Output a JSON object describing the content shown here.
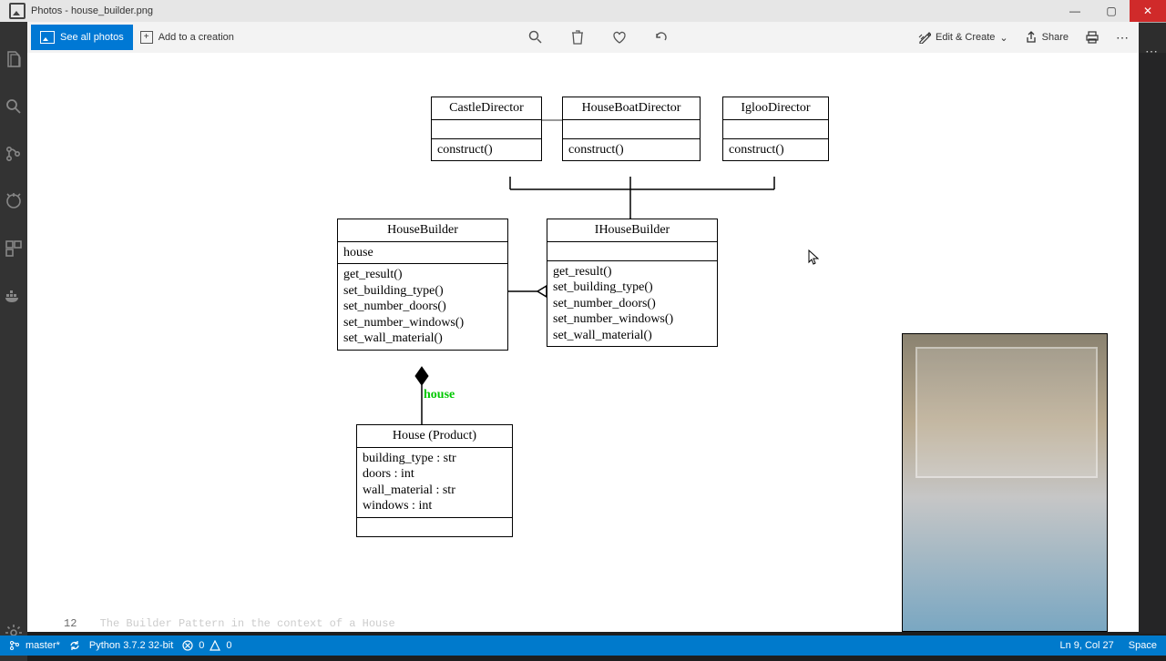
{
  "window": {
    "title": "Photos - house_builder.png",
    "buttons": {
      "min": "—",
      "max": "▢",
      "close": "✕"
    }
  },
  "toolbar": {
    "see_all": "See all photos",
    "add_creation": "Add to a creation",
    "edit_create": "Edit & Create",
    "share": "Share"
  },
  "diagram": {
    "rel_label": "house",
    "directors": [
      {
        "name": "CastleDirector",
        "method": "construct()"
      },
      {
        "name": "HouseBoatDirector",
        "method": "construct()"
      },
      {
        "name": "IglooDirector",
        "method": "construct()"
      }
    ],
    "builder": {
      "name": "HouseBuilder",
      "attr": "house",
      "methods": [
        "get_result()",
        "set_building_type()",
        "set_number_doors()",
        "set_number_windows()",
        "set_wall_material()"
      ]
    },
    "ibuilder": {
      "name": "IHouseBuilder",
      "methods": [
        "get_result()",
        "set_building_type()",
        "set_number_doors()",
        "set_number_windows()",
        "set_wall_material()"
      ]
    },
    "house": {
      "name": "House (Product)",
      "attrs": [
        "building_type : str",
        "doors : int",
        "wall_material : str",
        "windows : int"
      ]
    }
  },
  "vscode": {
    "code_line_num": "12",
    "code_line": "The Builder Pattern in the context of a House",
    "status": {
      "branch": "master*",
      "python": "Python 3.7.2 32-bit",
      "errors": "0",
      "warnings": "0",
      "position": "Ln 9, Col 27",
      "spaces": "Space"
    }
  }
}
